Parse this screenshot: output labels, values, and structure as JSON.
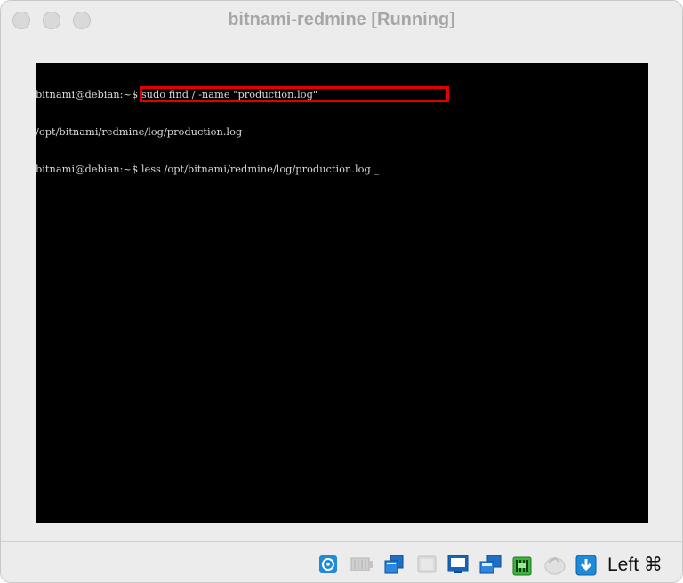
{
  "window": {
    "title": "bitnami-redmine [Running]"
  },
  "terminal": {
    "lines": [
      "bitnami@debian:~$ sudo find / -name \"production.log\"",
      "/opt/bitnami/redmine/log/production.log",
      "bitnami@debian:~$ less /opt/bitnami/redmine/log/production.log _"
    ]
  },
  "statusbar": {
    "icons": [
      "hard-disk-icon",
      "optical-drive-icon",
      "usb-icon",
      "shared-folders-icon",
      "display-icon",
      "recording-icon",
      "network-icon",
      "mouse-integration-icon",
      "keyboard-capture-icon"
    ],
    "host_key": "Left ⌘"
  }
}
